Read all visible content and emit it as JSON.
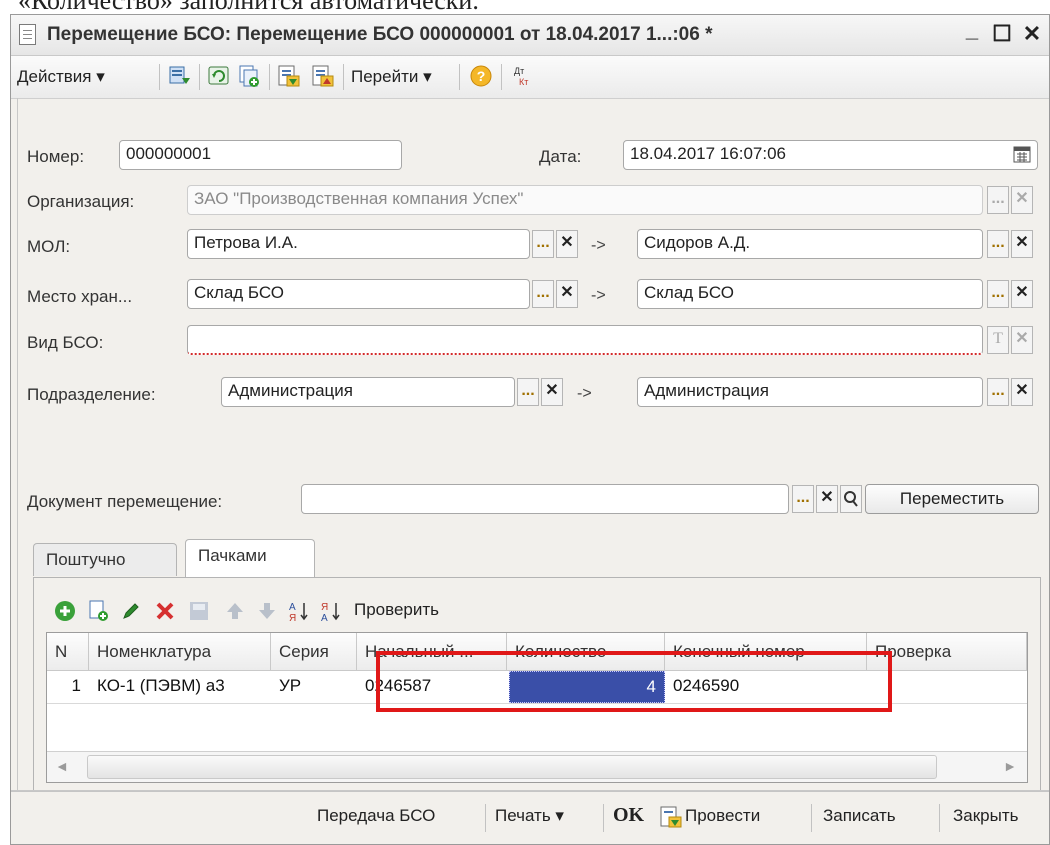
{
  "clipped_heading": "«Количество» заполнится автоматически.",
  "window": {
    "title": "Перемещение БСО: Перемещение БСО 000000001 от 18.04.2017 1...:06 *",
    "minimize": "_",
    "maximize": "☐",
    "close": "✕"
  },
  "toolbar": {
    "actions_label": "Действия ▾",
    "goto_label": "Перейти ▾",
    "help_label": "?",
    "dtkt_label": "Дт Кт"
  },
  "form": {
    "number_label": "Номер:",
    "number_value": "000000001",
    "date_label": "Дата:",
    "date_value": "18.04.2017 16:07:06",
    "org_label": "Организация:",
    "org_value": "ЗАО \"Производственная компания Успех\"",
    "mol_label": "МОЛ:",
    "mol_from": "Петрова И.А.",
    "mol_to": "Сидоров А.Д.",
    "storage_label": "Место хран...",
    "storage_from": "Склад БСО",
    "storage_to": "Склад БСО",
    "bso_type_label": "Вид БСО:",
    "bso_type_value": "",
    "dept_label": "Подразделение:",
    "dept_from": "Администрация",
    "dept_to": "Администрация",
    "arrow": "->",
    "move_doc_label": "Документ перемещение:",
    "move_doc_value": "",
    "move_button": "Переместить",
    "dots": "...",
    "clear": "✕",
    "type_t": "T"
  },
  "tabs": [
    {
      "label": "Поштучно",
      "active": false
    },
    {
      "label": "Пачками",
      "active": true
    }
  ],
  "grid_toolbar": {
    "check_label": "Проверить"
  },
  "table": {
    "columns": [
      "N",
      "Номенклатура",
      "Серия",
      "Начальный ...",
      "Количество",
      "Конечный номер",
      "Проверка"
    ],
    "rows": [
      {
        "n": "1",
        "nomenclature": "КО-1 (ПЭВМ) а3",
        "series": "УР",
        "start": "0246587",
        "qty": "4",
        "end": "0246590",
        "check": ""
      }
    ]
  },
  "bottom": {
    "transfer_label": "Передача БСО",
    "print_label": "Печать ▾",
    "ok_label": "OK",
    "post_label": "Провести",
    "save_label": "Записать",
    "close_label": "Закрыть"
  },
  "colors": {
    "highlight": "#e01818",
    "selection": "#3a4fa8"
  }
}
